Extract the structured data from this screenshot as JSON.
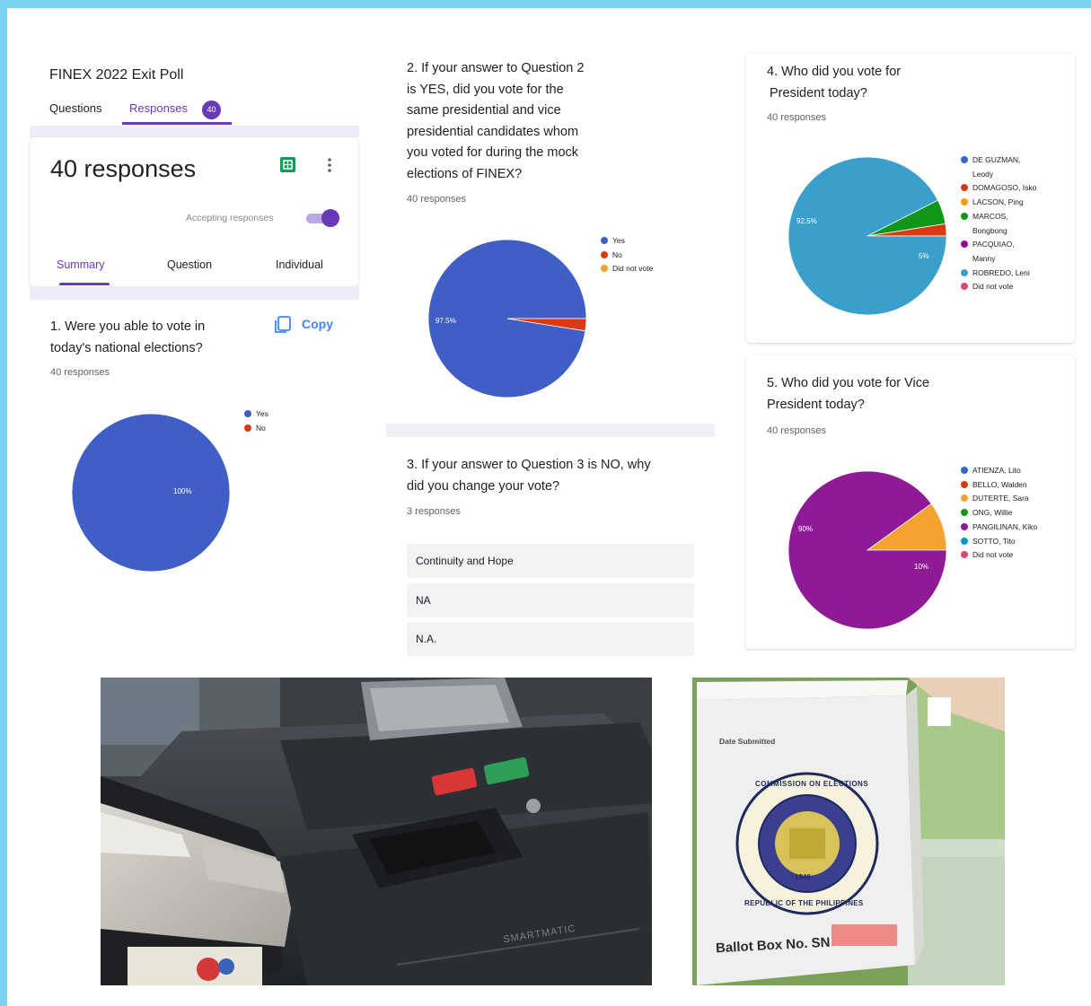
{
  "header": {
    "title": "FINEX 2022 Exit Poll",
    "tabs": [
      {
        "label": "Questions"
      },
      {
        "label": "Responses",
        "badge": "40"
      }
    ]
  },
  "summary_card": {
    "count_label": "40 responses",
    "accepting_label": "Accepting responses",
    "accepting_on": true,
    "subtabs": [
      "Summary",
      "Question",
      "Individual"
    ],
    "active_subtab": "Summary"
  },
  "colors": {
    "accent": "#673ab7",
    "sheets_green": "#0f9d58",
    "frame": "#7ad3f0"
  },
  "q1": {
    "text_line1": "1. Were you able to vote in",
    "text_line2": "today's national elections?",
    "responses": "40 responses",
    "copy_label": "Copy",
    "chart_data": {
      "type": "pie",
      "categories": [
        "Yes",
        "No"
      ],
      "values": [
        100,
        0
      ],
      "colors": [
        "#3f5fc7",
        "#dc3912"
      ],
      "labels": [
        "100%"
      ]
    }
  },
  "q2": {
    "lines": [
      "2. If your answer to Question 2",
      "is YES, did you vote for the",
      "same presidential and vice",
      "presidential candidates whom",
      "you voted for during the mock",
      "elections of FINEX?"
    ],
    "responses": "40 responses",
    "chart_data": {
      "type": "pie",
      "categories": [
        "Yes",
        "No",
        "Did not vote"
      ],
      "values": [
        97.5,
        2.5,
        0
      ],
      "colors": [
        "#3f5fc7",
        "#dc3912",
        "#f4a230"
      ],
      "labels": [
        "97.5%"
      ]
    }
  },
  "q3": {
    "text_line1": "3. If your answer to Question 3 is NO, why",
    "text_line2": "did you change your vote?",
    "responses": "3 responses",
    "answers": [
      "Continuity and Hope",
      "NA",
      "N.A."
    ]
  },
  "q4": {
    "text_line1": "4. Who did you vote for",
    "text_line2": "President today?",
    "responses": "40 responses",
    "chart_data": {
      "type": "pie",
      "categories": [
        "DE GUZMAN, Leody",
        "DOMAGOSO, Isko",
        "LACSON, Ping",
        "MARCOS, Bongbong",
        "PACQUIAO, Manny",
        "ROBREDO, Leni",
        "Did not vote"
      ],
      "legend_lines": [
        [
          "DE GUZMAN,",
          "Leody"
        ],
        [
          "DOMAGOSO, Isko"
        ],
        [
          "LACSON, Ping"
        ],
        [
          "MARCOS,",
          "Bongbong"
        ],
        [
          "PACQUIAO,",
          "Manny"
        ],
        [
          "ROBREDO, Leni"
        ],
        [
          "Did not vote"
        ]
      ],
      "values": [
        0,
        2.5,
        0,
        5,
        0,
        92.5,
        0
      ],
      "colors": [
        "#3366cc",
        "#dc3912",
        "#ff9900",
        "#109618",
        "#990099",
        "#3b9fcb",
        "#dd4477"
      ],
      "labels": [
        "92.5%",
        "5%"
      ]
    }
  },
  "q5": {
    "text_line1": "5. Who did you vote for Vice",
    "text_line2": "President today?",
    "responses": "40 responses",
    "chart_data": {
      "type": "pie",
      "categories": [
        "ATIENZA, Lito",
        "BELLO, Walden",
        "DUTERTE, Sara",
        "ONG, Willie",
        "PANGILINAN, Kiko",
        "SOTTO, Tito",
        "Did not vote"
      ],
      "values": [
        0,
        0,
        10,
        0,
        90,
        0,
        0
      ],
      "colors": [
        "#3366cc",
        "#dc3912",
        "#f4a230",
        "#109618",
        "#8e1a96",
        "#0099c6",
        "#dd4477"
      ],
      "labels": [
        "90%",
        "10%"
      ]
    }
  },
  "photos": {
    "machine_brand": "SMARTMATIC",
    "ballot_box_date_label": "Date Submitted",
    "ballot_box_label": "Ballot Box No. SN",
    "seal_top_text": "COMMISSION ON ELECTIONS",
    "seal_bottom_text": "REPUBLIC OF THE PHILIPPINES",
    "seal_year": "1940"
  }
}
